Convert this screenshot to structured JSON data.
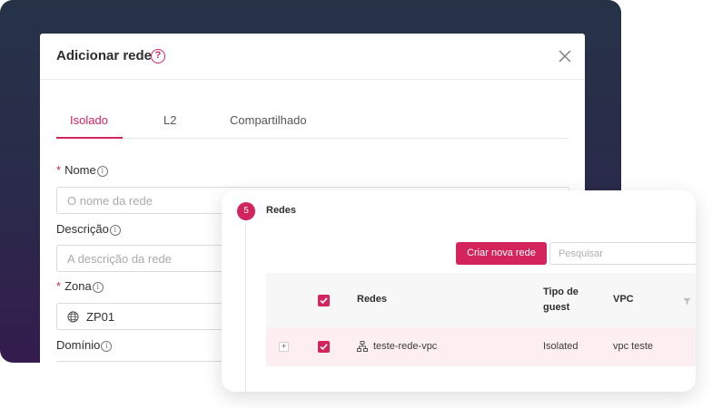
{
  "modal": {
    "title": "Adicionar rede",
    "help_icon": "?",
    "tabs": [
      {
        "label": "Isolado",
        "active": true
      },
      {
        "label": "L2",
        "active": false
      },
      {
        "label": "Compartilhado",
        "active": false
      }
    ],
    "fields": {
      "name": {
        "label": "Nome",
        "required": true,
        "placeholder": "O nome da rede"
      },
      "description": {
        "label": "Descrição",
        "required": false,
        "placeholder": "A descrição da rede"
      },
      "zone": {
        "label": "Zona",
        "required": true,
        "value": "ZP01",
        "icon": "globe-icon"
      },
      "domain": {
        "label": "Domínio",
        "required": false
      }
    },
    "required_mark": "*",
    "info_mark": "i"
  },
  "networks_panel": {
    "step_number": "5",
    "step_title": "Redes",
    "create_button": "Criar nova rede",
    "search_placeholder": "Pesquisar",
    "columns": {
      "networks": "Redes",
      "guest_type": "Tipo de guest",
      "vpc": "VPC"
    },
    "rows": [
      {
        "expand": "+",
        "checked": true,
        "name": "teste-rede-vpc",
        "guest_type": "Isolated",
        "vpc": "vpc teste",
        "icon": "network-icon"
      }
    ]
  },
  "colors": {
    "accent": "#d3245d",
    "selected_row": "#fdeef1",
    "backdrop_top": "#263347",
    "backdrop_bottom": "#341c4e"
  }
}
